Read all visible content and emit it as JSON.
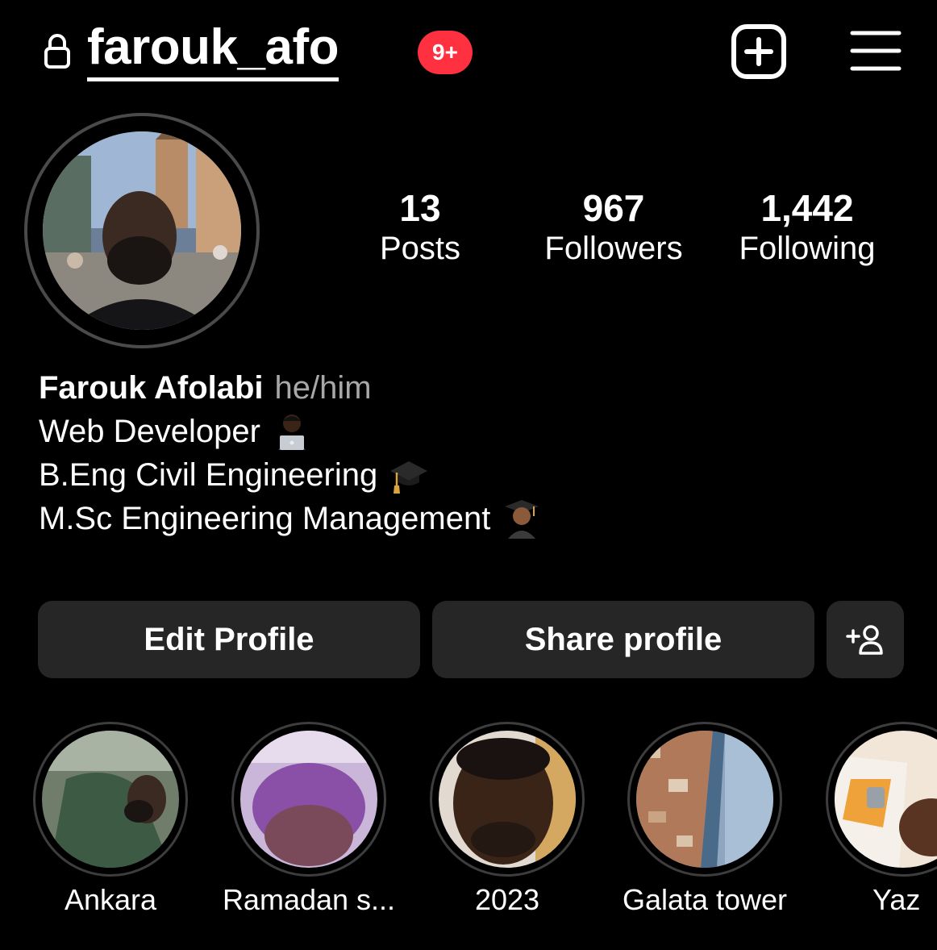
{
  "header": {
    "username": "farouk_afo",
    "notification_badge": "9+",
    "icons": [
      "lock-icon",
      "create-post-icon",
      "menu-icon"
    ],
    "badge_color": "#ff3040"
  },
  "stats": [
    {
      "value": "13",
      "label": "Posts"
    },
    {
      "value": "967",
      "label": "Followers"
    },
    {
      "value": "1,442",
      "label": "Following"
    }
  ],
  "bio": {
    "name": "Farouk Afolabi",
    "pronouns": "he/him",
    "lines": [
      {
        "text": "Web Developer",
        "emoji": "technologist-emoji"
      },
      {
        "text": "B.Eng Civil Engineering",
        "emoji": "graduation-cap-emoji"
      },
      {
        "text": "M.Sc Engineering Management",
        "emoji": "student-emoji"
      }
    ]
  },
  "actions": {
    "edit_profile": "Edit Profile",
    "share_profile": "Share profile",
    "add_person_icon": "add-person-icon"
  },
  "highlights": [
    {
      "label": "Ankara"
    },
    {
      "label": "Ramadan s..."
    },
    {
      "label": "2023"
    },
    {
      "label": "Galata tower"
    },
    {
      "label": "Yaz"
    }
  ],
  "colors": {
    "background": "#000000",
    "button": "#262626",
    "secondary_text": "#a8a8a8"
  }
}
